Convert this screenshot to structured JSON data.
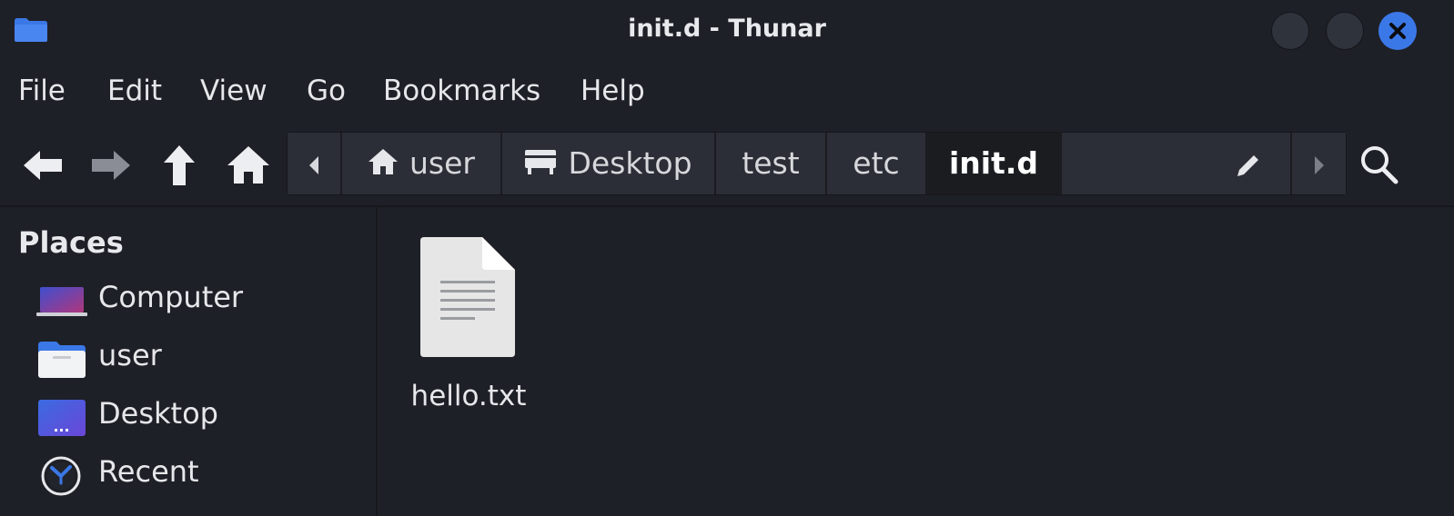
{
  "window": {
    "title": "init.d - Thunar",
    "close_color": "#3b78e7"
  },
  "menu": {
    "items": [
      "File",
      "Edit",
      "View",
      "Go",
      "Bookmarks",
      "Help"
    ]
  },
  "toolbar": {
    "icons": [
      "back-arrow-icon",
      "forward-arrow-icon",
      "up-arrow-icon",
      "home-icon",
      "search-icon"
    ]
  },
  "pathbar": {
    "crumbs": [
      {
        "label": "user",
        "icon": "home-icon"
      },
      {
        "label": "Desktop",
        "icon": "desktop-icon"
      },
      {
        "label": "test"
      },
      {
        "label": "etc"
      },
      {
        "label": "init.d",
        "active": true
      }
    ]
  },
  "sidebar": {
    "header": "Places",
    "items": [
      {
        "label": "Computer",
        "icon": "computer-icon"
      },
      {
        "label": "user",
        "icon": "user-folder-icon"
      },
      {
        "label": "Desktop",
        "icon": "desktop-folder-icon"
      },
      {
        "label": "Recent",
        "icon": "recent-clock-icon"
      }
    ]
  },
  "files": [
    {
      "name": "hello.txt",
      "icon": "text-file-icon"
    }
  ]
}
